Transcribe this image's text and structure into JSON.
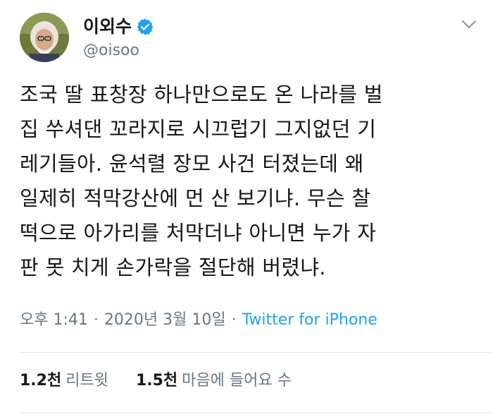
{
  "author": {
    "display_name": "이외수",
    "handle": "@oisoo",
    "verified_icon": "verified-badge-icon",
    "badge_color": "#1da1f2"
  },
  "tweet": {
    "text": "조국 딸 표창장 하나만으로도 온 나라를 벌\n집 쑤셔댄 꼬라지로 시끄럽기 그지없던 기\n레기들아. 윤석렬 장모 사건 터졌는데 왜\n일제히 적막강산에 먼 산 보기냐. 무슨 찰\n떡으로 아가리를 처막더냐 아니면 누가 자\n판 못 치게 손가락을 절단해 버렸냐."
  },
  "meta": {
    "time": "오후 1:41",
    "separator": "·",
    "date": "2020년 3월 10일",
    "source": "Twitter for iPhone"
  },
  "stats": {
    "retweets_count": "1.2천",
    "retweets_label": "리트윗",
    "likes_count": "1.5천",
    "likes_label": "마음에 들어요 수"
  },
  "colors": {
    "text": "#14171a",
    "secondary": "#657786",
    "link": "#1da1f2",
    "divider": "#e1e8ed"
  }
}
